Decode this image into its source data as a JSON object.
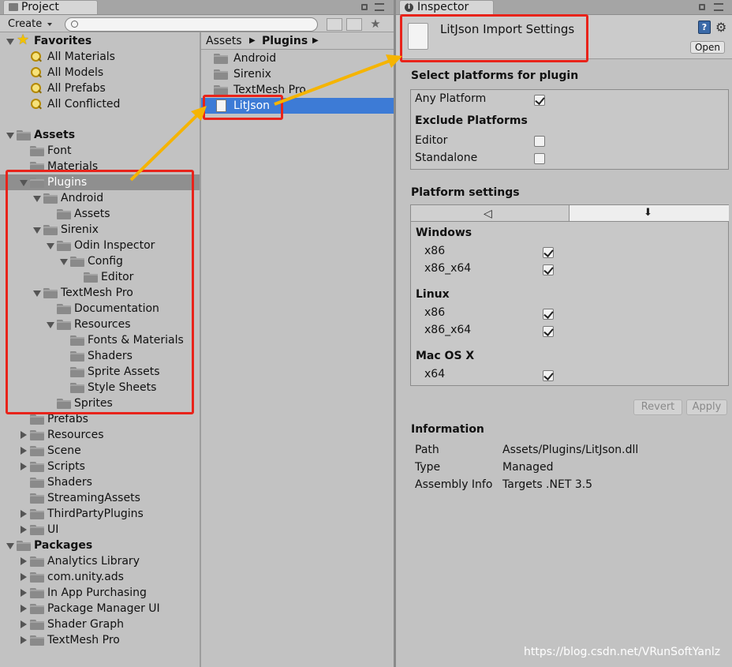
{
  "project_panel": {
    "tab_label": "Project",
    "create_label": "Create",
    "search_placeholder": "",
    "tree": [
      {
        "label": "Favorites",
        "bold": true,
        "level": 0,
        "type": "star",
        "expanded": true
      },
      {
        "label": "All Materials",
        "level": 1,
        "type": "search"
      },
      {
        "label": "All Models",
        "level": 1,
        "type": "search"
      },
      {
        "label": "All Prefabs",
        "level": 1,
        "type": "search"
      },
      {
        "label": "All Conflicted",
        "level": 1,
        "type": "search"
      },
      {
        "label": "",
        "level": 0,
        "type": "spacer"
      },
      {
        "label": "Assets",
        "bold": true,
        "level": 0,
        "type": "folder",
        "expanded": true
      },
      {
        "label": "Font",
        "level": 1,
        "type": "folder"
      },
      {
        "label": "Materials",
        "level": 1,
        "type": "folder"
      },
      {
        "label": "Plugins",
        "level": 1,
        "type": "folder",
        "expanded": true,
        "selected": true
      },
      {
        "label": "Android",
        "level": 2,
        "type": "folder",
        "expanded": true
      },
      {
        "label": "Assets",
        "level": 3,
        "type": "folder"
      },
      {
        "label": "Sirenix",
        "level": 2,
        "type": "folder",
        "expanded": true
      },
      {
        "label": "Odin Inspector",
        "level": 3,
        "type": "folder",
        "expanded": true
      },
      {
        "label": "Config",
        "level": 4,
        "type": "folder",
        "expanded": true
      },
      {
        "label": "Editor",
        "level": 5,
        "type": "folder"
      },
      {
        "label": "TextMesh Pro",
        "level": 2,
        "type": "folder",
        "expanded": true
      },
      {
        "label": "Documentation",
        "level": 3,
        "type": "folder"
      },
      {
        "label": "Resources",
        "level": 3,
        "type": "folder",
        "expanded": true
      },
      {
        "label": "Fonts & Materials",
        "level": 4,
        "type": "folder"
      },
      {
        "label": "Shaders",
        "level": 4,
        "type": "folder"
      },
      {
        "label": "Sprite Assets",
        "level": 4,
        "type": "folder"
      },
      {
        "label": "Style Sheets",
        "level": 4,
        "type": "folder"
      },
      {
        "label": "Sprites",
        "level": 3,
        "type": "folder"
      },
      {
        "label": "Prefabs",
        "level": 1,
        "type": "folder"
      },
      {
        "label": "Resources",
        "level": 1,
        "type": "folder",
        "collapsed": true
      },
      {
        "label": "Scene",
        "level": 1,
        "type": "folder",
        "collapsed": true
      },
      {
        "label": "Scripts",
        "level": 1,
        "type": "folder",
        "collapsed": true
      },
      {
        "label": "Shaders",
        "level": 1,
        "type": "folder"
      },
      {
        "label": "StreamingAssets",
        "level": 1,
        "type": "folder"
      },
      {
        "label": "ThirdPartyPlugins",
        "level": 1,
        "type": "folder",
        "collapsed": true
      },
      {
        "label": "UI",
        "level": 1,
        "type": "folder",
        "collapsed": true
      },
      {
        "label": "Packages",
        "bold": true,
        "level": 0,
        "type": "folder",
        "expanded": true
      },
      {
        "label": "Analytics Library",
        "level": 1,
        "type": "folder",
        "collapsed": true
      },
      {
        "label": "com.unity.ads",
        "level": 1,
        "type": "folder",
        "collapsed": true
      },
      {
        "label": "In App Purchasing",
        "level": 1,
        "type": "folder",
        "collapsed": true
      },
      {
        "label": "Package Manager UI",
        "level": 1,
        "type": "folder",
        "collapsed": true
      },
      {
        "label": "Shader Graph",
        "level": 1,
        "type": "folder",
        "collapsed": true
      },
      {
        "label": "TextMesh Pro",
        "level": 1,
        "type": "folder",
        "collapsed": true
      }
    ],
    "breadcrumb": [
      "Assets",
      "Plugins"
    ],
    "files": [
      {
        "label": "Android",
        "type": "folder"
      },
      {
        "label": "Sirenix",
        "type": "folder"
      },
      {
        "label": "TextMesh Pro",
        "type": "folder"
      },
      {
        "label": "LitJson",
        "type": "file",
        "selected": true
      }
    ]
  },
  "inspector": {
    "tab_label": "Inspector",
    "title": "LitJson Import Settings",
    "open_label": "Open",
    "select_platforms_heading": "Select platforms for plugin",
    "any_platform_label": "Any Platform",
    "any_platform_checked": true,
    "exclude_heading": "Exclude Platforms",
    "exclude": [
      {
        "label": "Editor",
        "checked": false
      },
      {
        "label": "Standalone",
        "checked": false
      }
    ],
    "platform_settings_heading": "Platform settings",
    "groups": [
      {
        "name": "Windows",
        "items": [
          {
            "label": "x86",
            "checked": true
          },
          {
            "label": "x86_x64",
            "checked": true
          }
        ]
      },
      {
        "name": "Linux",
        "items": [
          {
            "label": "x86",
            "checked": true
          },
          {
            "label": "x86_x64",
            "checked": true
          }
        ]
      },
      {
        "name": "Mac OS X",
        "items": [
          {
            "label": "x64",
            "checked": true
          }
        ]
      }
    ],
    "revert_label": "Revert",
    "apply_label": "Apply",
    "information_heading": "Information",
    "info": [
      {
        "key": "Path",
        "value": "Assets/Plugins/LitJson.dll"
      },
      {
        "key": "Type",
        "value": "Managed"
      },
      {
        "key": "Assembly Info",
        "value": "Targets .NET 3.5"
      }
    ]
  },
  "watermark": "https://blog.csdn.net/VRunSoftYanlz"
}
